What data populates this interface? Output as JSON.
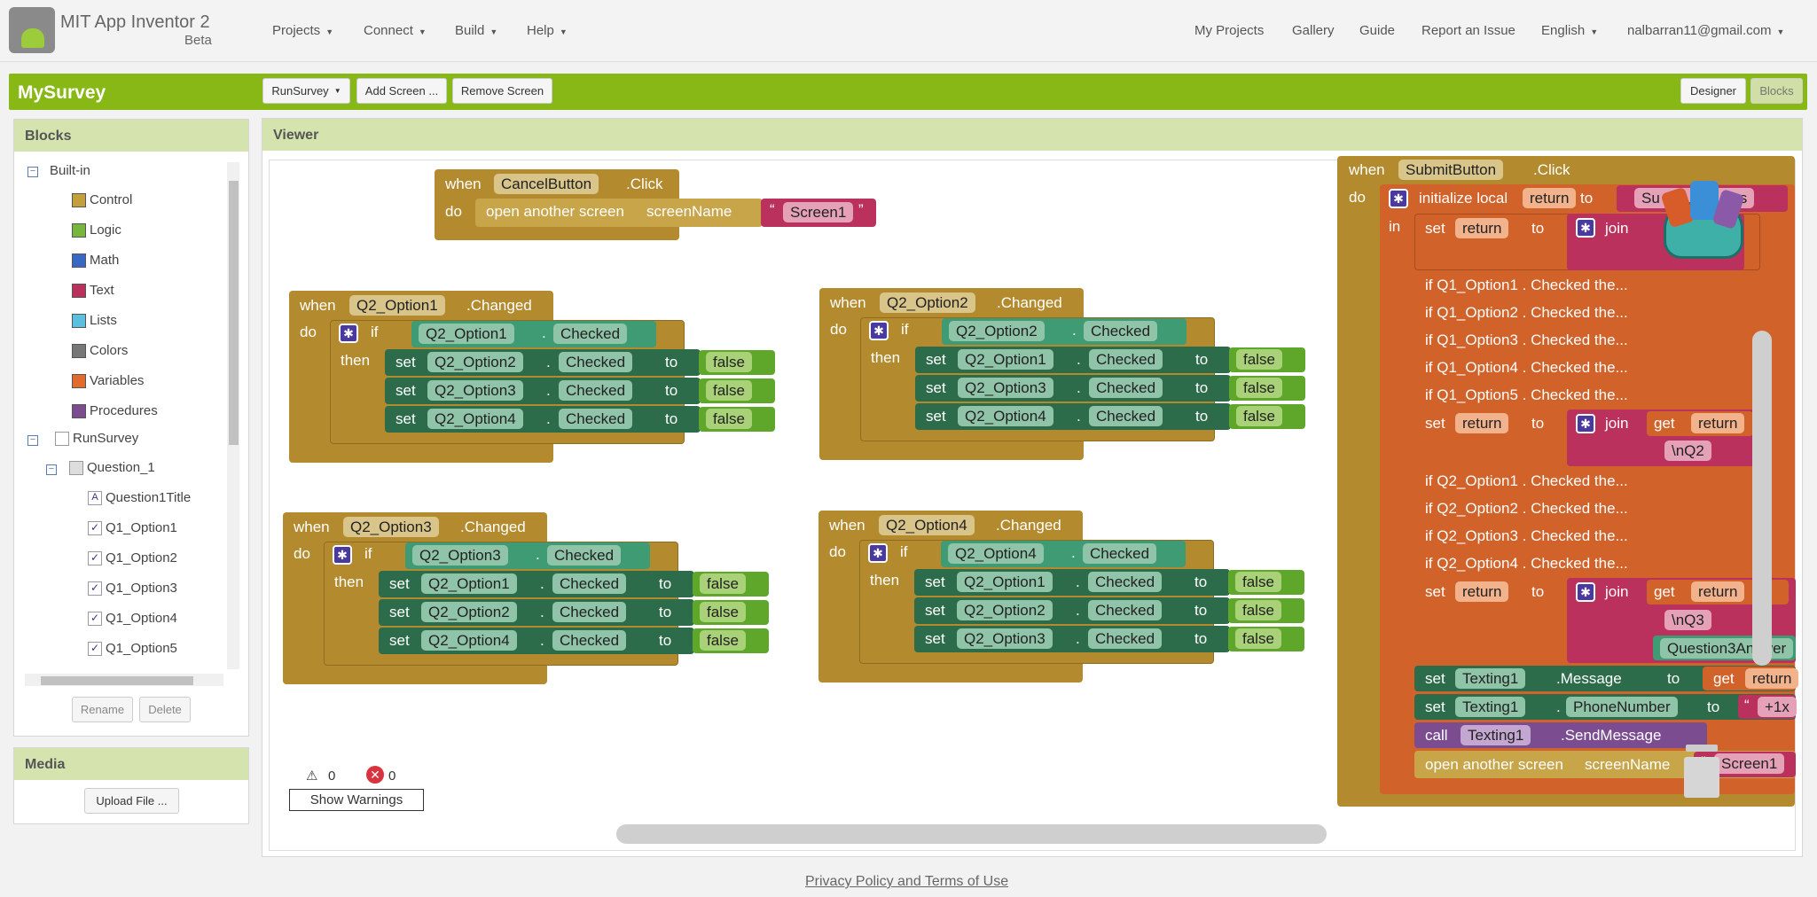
{
  "header": {
    "brand": "MIT App Inventor 2",
    "badge": "Beta",
    "nav_left": [
      "Projects",
      "Connect",
      "Build",
      "Help"
    ],
    "nav_right": [
      "My Projects",
      "Gallery",
      "Guide",
      "Report an Issue",
      "English",
      "nalbarran11@gmail.com"
    ]
  },
  "project": {
    "name": "MySurvey",
    "screen_selector": "RunSurvey",
    "add_screen": "Add Screen ...",
    "remove_screen": "Remove Screen",
    "designer": "Designer",
    "blocks": "Blocks"
  },
  "blocks_panel": {
    "title": "Blocks",
    "builtin": "Built-in",
    "categories": [
      {
        "label": "Control",
        "color": "#c4a03d"
      },
      {
        "label": "Logic",
        "color": "#76b63c"
      },
      {
        "label": "Math",
        "color": "#3868c4"
      },
      {
        "label": "Text",
        "color": "#b9315c"
      },
      {
        "label": "Lists",
        "color": "#5bbfe0"
      },
      {
        "label": "Colors",
        "color": "#777777"
      },
      {
        "label": "Variables",
        "color": "#e06b2a"
      },
      {
        "label": "Procedures",
        "color": "#7b4c8f"
      }
    ],
    "screen": "RunSurvey",
    "arrangement": "Question_1",
    "components": [
      "Question1Title",
      "Q1_Option1",
      "Q1_Option2",
      "Q1_Option3",
      "Q1_Option4",
      "Q1_Option5"
    ],
    "rename": "Rename",
    "delete": "Delete"
  },
  "media": {
    "title": "Media",
    "upload": "Upload File ..."
  },
  "viewer": {
    "title": "Viewer",
    "warnings": "0",
    "errors": "0",
    "show_warnings": "Show Warnings"
  },
  "words": {
    "when": "when",
    "do": "do",
    "if": "if",
    "then": "then",
    "set": "set",
    "to": "to",
    "dot": ".",
    "in": "in",
    "join": "join",
    "get": "get",
    "call": "call",
    "open": "open another screen",
    "screenName": "screenName",
    "init": "initialize local",
    "q": "“",
    "qe": "”"
  },
  "blocks": {
    "cancel": {
      "component": "CancelButton",
      "event": ".Click",
      "screen": "Screen1"
    },
    "opt1": {
      "component": "Q2_Option1",
      "event": ".Changed",
      "cond": "Q2_Option1",
      "sets": [
        "Q2_Option2",
        "Q2_Option3",
        "Q2_Option4"
      ]
    },
    "opt2": {
      "component": "Q2_Option2",
      "event": ".Changed",
      "cond": "Q2_Option2",
      "sets": [
        "Q2_Option1",
        "Q2_Option3",
        "Q2_Option4"
      ]
    },
    "opt3": {
      "component": "Q2_Option3",
      "event": ".Changed",
      "cond": "Q2_Option3",
      "sets": [
        "Q2_Option1",
        "Q2_Option2",
        "Q2_Option4"
      ]
    },
    "opt4": {
      "component": "Q2_Option4",
      "event": ".Changed",
      "cond": "Q2_Option4",
      "sets": [
        "Q2_Option1",
        "Q2_Option2",
        "Q2_Option3"
      ]
    },
    "prop": "Checked",
    "false": "false",
    "submit": {
      "component": "SubmitButton",
      "event": ".Click",
      "var": "return",
      "init_text": "Su",
      "init_text2": "s",
      "collapsed": [
        "if Q1_Option1 . Checked the...",
        "if Q1_Option2 . Checked the...",
        "if Q1_Option3 . Checked the...",
        "if Q1_Option4 . Checked the...",
        "if Q1_Option5 . Checked the..."
      ],
      "collapsed2": [
        "if Q2_Option1 . Checked the...",
        "if Q2_Option2 . Checked the...",
        "if Q2_Option3 . Checked the...",
        "if Q2_Option4 . Checked the..."
      ],
      "nq2": "\\nQ2",
      "nq3": "\\nQ3",
      "q3answer": "Question3Answer",
      "texting": "Texting1",
      "message": ".Message",
      "phone": "PhoneNumber",
      "phone_val": "+1x",
      "send": ".SendMessage",
      "screen": "Screen1"
    }
  },
  "footer": {
    "link": "Privacy Policy and Terms of Use"
  }
}
